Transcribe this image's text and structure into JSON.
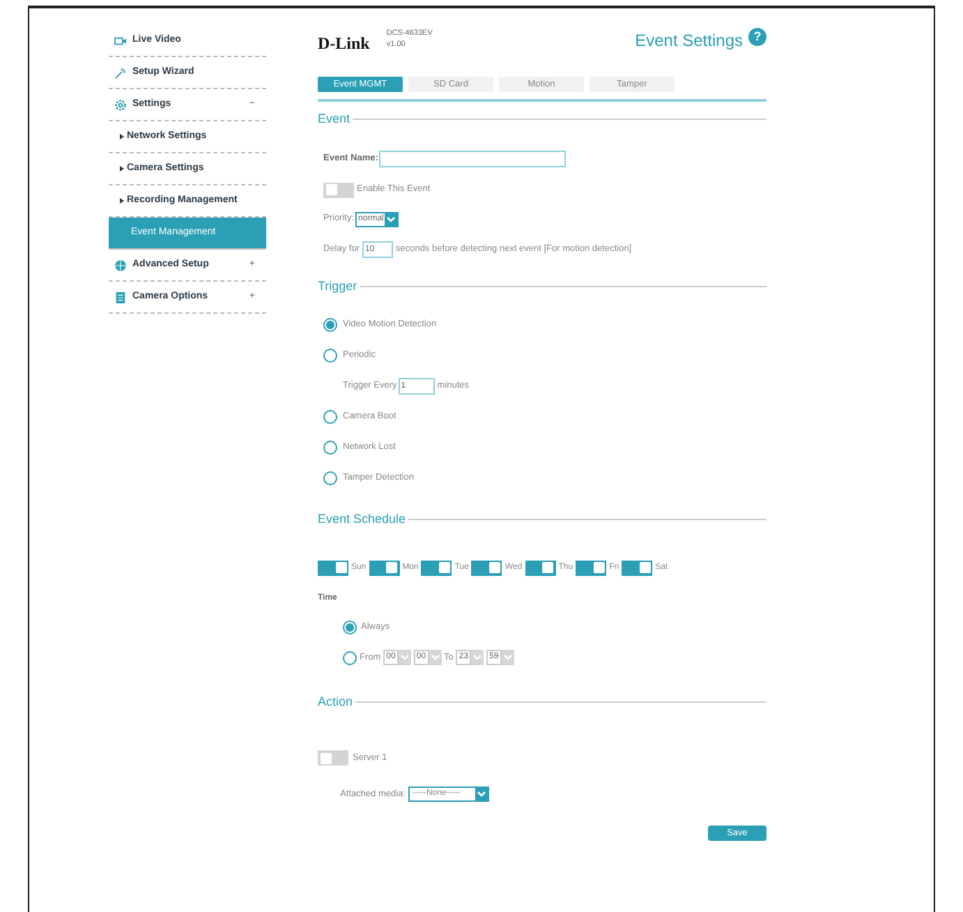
{
  "sidebar": {
    "items": [
      {
        "label": "Live Video",
        "selected": false
      },
      {
        "label": "Setup Wizard",
        "selected": false
      },
      {
        "label": "Settings",
        "toggle": "−",
        "selected": false,
        "children": [
          {
            "label": "Network Settings",
            "selected": false
          },
          {
            "label": "Camera Settings",
            "selected": false
          },
          {
            "label": "Recording Management",
            "selected": false,
            "children": [
              {
                "label": "Event Management",
                "selected": true
              }
            ]
          }
        ]
      },
      {
        "label": "Advanced Setup",
        "toggle": "+",
        "selected": false
      },
      {
        "label": "Camera Options",
        "toggle": "+",
        "selected": false
      }
    ]
  },
  "header": {
    "logo": "D-Link",
    "model": "DCS-4633EV",
    "version": "v1.00",
    "title": "Event Settings",
    "help": "?"
  },
  "tabs": [
    {
      "label": "Event MGMT",
      "selected": true
    },
    {
      "label": "SD Card",
      "selected": false
    },
    {
      "label": "Motion",
      "selected": false
    },
    {
      "label": "Tamper",
      "selected": false
    }
  ],
  "event": {
    "heading": "Event",
    "name_label": "Event Name:",
    "enable_label": "Enable This Event",
    "enabled": false,
    "priority_label": "Priority:",
    "priority_value": "normal",
    "delay_label": "Delay for",
    "delay_value": "10",
    "delay_suffix": "seconds before detecting next event [For motion detection]"
  },
  "trigger": {
    "heading": "Trigger",
    "options": [
      {
        "label": "Video Motion Detection",
        "selected": true
      },
      {
        "label": "Periodic",
        "selected": false,
        "sub_label": "Trigger Every",
        "sub_value": "1",
        "sub_suffix": "minutes"
      },
      {
        "label": "Camera Boot",
        "selected": false
      },
      {
        "label": "Network Lost",
        "selected": false
      },
      {
        "label": "Tamper Detection",
        "selected": false
      }
    ]
  },
  "schedule": {
    "heading": "Event Schedule",
    "days": [
      {
        "label": "Sun",
        "on": true
      },
      {
        "label": "Mon",
        "on": true
      },
      {
        "label": "Tue",
        "on": true
      },
      {
        "label": "Wed",
        "on": true
      },
      {
        "label": "Thu",
        "on": true
      },
      {
        "label": "Fri",
        "on": true
      },
      {
        "label": "Sat",
        "on": true
      }
    ],
    "time_label": "Time",
    "always_label": "Always",
    "always_selected": true,
    "from_label": "From",
    "from_selected": false,
    "from_hour": "00",
    "from_minute": "00",
    "to_label": "To",
    "to_hour": "23",
    "to_minute": "59"
  },
  "action": {
    "heading": "Action",
    "server_label": "Server 1",
    "server_on": false,
    "media_label": "Attached media:",
    "media_value": "-----None-----"
  },
  "save": "Save"
}
